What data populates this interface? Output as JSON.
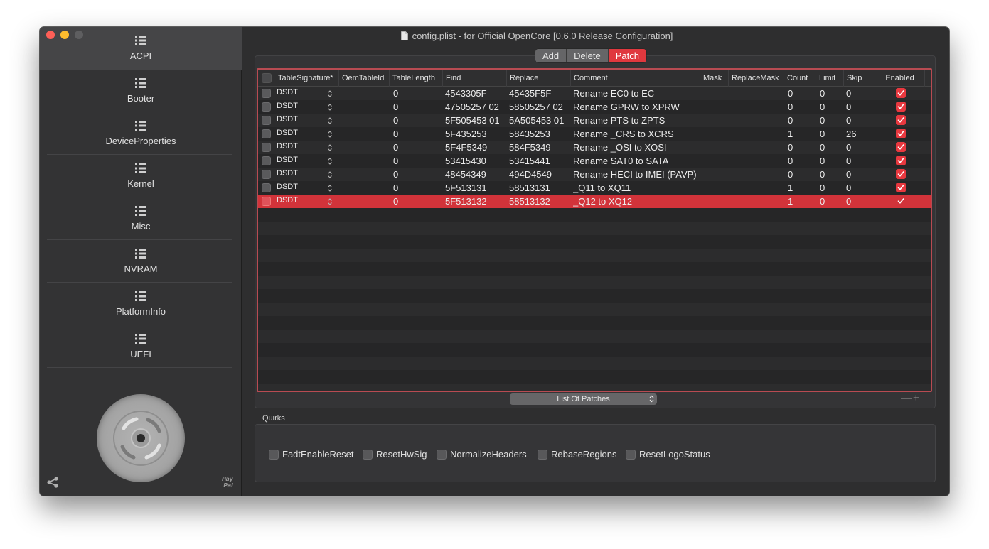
{
  "window": {
    "title": "config.plist - for Official OpenCore [0.6.0 Release Configuration]"
  },
  "sidebar": {
    "items": [
      {
        "label": "ACPI",
        "active": true
      },
      {
        "label": "Booter",
        "active": false
      },
      {
        "label": "DeviceProperties",
        "active": false
      },
      {
        "label": "Kernel",
        "active": false
      },
      {
        "label": "Misc",
        "active": false
      },
      {
        "label": "NVRAM",
        "active": false
      },
      {
        "label": "PlatformInfo",
        "active": false
      },
      {
        "label": "UEFI",
        "active": false
      }
    ],
    "paypal_line1": "Pay",
    "paypal_line2": "Pal"
  },
  "segments": {
    "add": "Add",
    "delete": "Delete",
    "patch": "Patch",
    "active": "Patch"
  },
  "table": {
    "columns": [
      "TableSignature*",
      "OemTableId",
      "TableLength",
      "Find",
      "Replace",
      "Comment",
      "Mask",
      "ReplaceMask",
      "Count",
      "Limit",
      "Skip",
      "Enabled"
    ],
    "rows": [
      {
        "sig": "DSDT",
        "oem": "",
        "len": "0",
        "find": "4543305F",
        "replace": "45435F5F",
        "comment": "Rename EC0 to EC",
        "mask": "",
        "rmask": "",
        "count": "0",
        "limit": "0",
        "skip": "0",
        "enabled": true
      },
      {
        "sig": "DSDT",
        "oem": "",
        "len": "0",
        "find": "47505257 02",
        "replace": "58505257 02",
        "comment": "Rename GPRW to XPRW",
        "mask": "",
        "rmask": "",
        "count": "0",
        "limit": "0",
        "skip": "0",
        "enabled": true
      },
      {
        "sig": "DSDT",
        "oem": "",
        "len": "0",
        "find": "5F505453 01",
        "replace": "5A505453 01",
        "comment": "Rename PTS to ZPTS",
        "mask": "",
        "rmask": "",
        "count": "0",
        "limit": "0",
        "skip": "0",
        "enabled": true
      },
      {
        "sig": "DSDT",
        "oem": "",
        "len": "0",
        "find": "5F435253",
        "replace": "58435253",
        "comment": "Rename _CRS to XCRS",
        "mask": "",
        "rmask": "",
        "count": "1",
        "limit": "0",
        "skip": "26",
        "enabled": true
      },
      {
        "sig": "DSDT",
        "oem": "",
        "len": "0",
        "find": "5F4F5349",
        "replace": "584F5349",
        "comment": "Rename _OSI to XOSI",
        "mask": "",
        "rmask": "",
        "count": "0",
        "limit": "0",
        "skip": "0",
        "enabled": true
      },
      {
        "sig": "DSDT",
        "oem": "",
        "len": "0",
        "find": "53415430",
        "replace": "53415441",
        "comment": "Rename SAT0 to SATA",
        "mask": "",
        "rmask": "",
        "count": "0",
        "limit": "0",
        "skip": "0",
        "enabled": true
      },
      {
        "sig": "DSDT",
        "oem": "",
        "len": "0",
        "find": "48454349",
        "replace": "494D4549",
        "comment": "Rename HECI to IMEI (PAVP)",
        "mask": "",
        "rmask": "",
        "count": "0",
        "limit": "0",
        "skip": "0",
        "enabled": true
      },
      {
        "sig": "DSDT",
        "oem": "",
        "len": "0",
        "find": "5F513131",
        "replace": "58513131",
        "comment": "_Q11 to XQ11",
        "mask": "",
        "rmask": "",
        "count": "1",
        "limit": "0",
        "skip": "0",
        "enabled": true
      },
      {
        "sig": "DSDT",
        "oem": "",
        "len": "0",
        "find": "5F513132",
        "replace": "58513132",
        "comment": "_Q12 to XQ12",
        "mask": "",
        "rmask": "",
        "count": "1",
        "limit": "0",
        "skip": "0",
        "enabled": true,
        "selected": true
      }
    ]
  },
  "list_selector": {
    "value": "List Of Patches"
  },
  "plus_minus": "—+",
  "quirks": {
    "title": "Quirks",
    "items": [
      {
        "label": "FadtEnableReset",
        "checked": false
      },
      {
        "label": "ResetHwSig",
        "checked": false
      },
      {
        "label": "NormalizeHeaders",
        "checked": false
      },
      {
        "label": "RebaseRegions",
        "checked": false
      },
      {
        "label": "ResetLogoStatus",
        "checked": false
      }
    ]
  },
  "colors": {
    "accent": "#e0383e",
    "selection": "#d2333a",
    "window_bg": "#2e2e2f",
    "sidebar_bg": "#333334"
  }
}
